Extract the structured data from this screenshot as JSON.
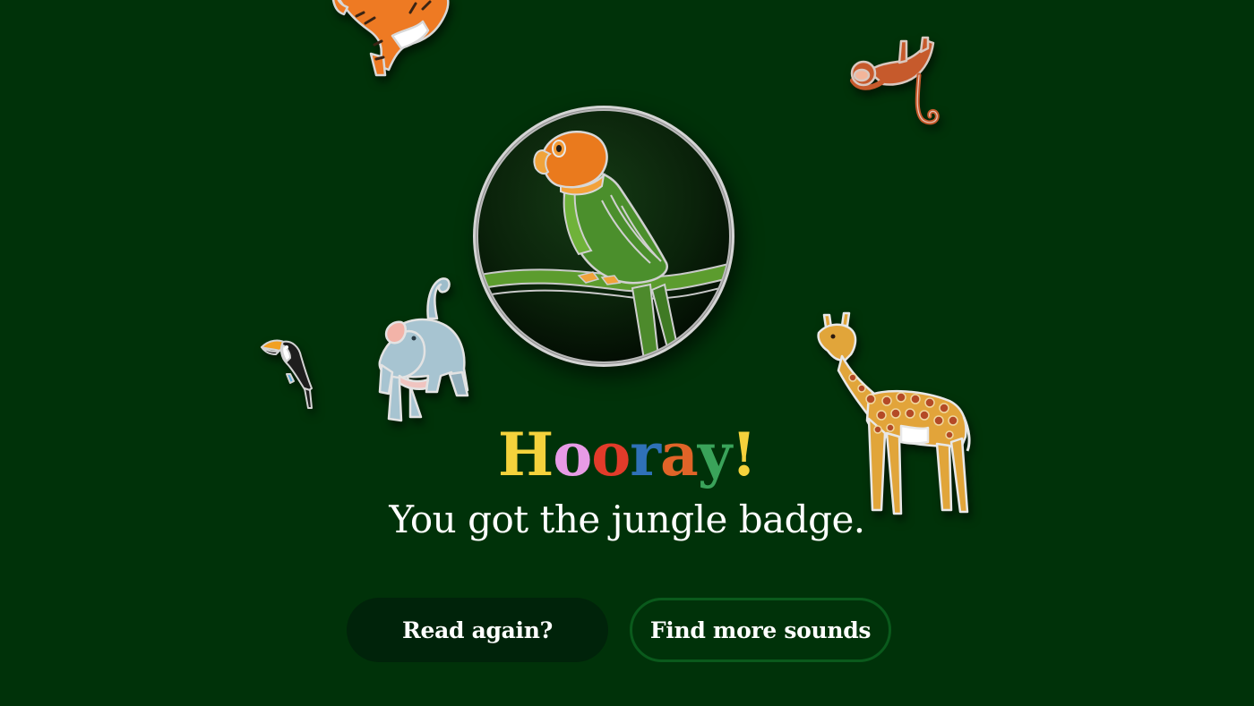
{
  "colors": {
    "background": "#003209",
    "read_button_bg": "#00230a",
    "find_button_border": "#0a5a1c",
    "text": "#ffffff"
  },
  "stickers": {
    "tiger": "tiger-sticker",
    "monkey": "monkey-sticker",
    "toucan": "toucan-sticker",
    "elephant": "elephant-sticker",
    "giraffe": "giraffe-sticker",
    "badge": "parrot-badge"
  },
  "headline": {
    "letters": [
      {
        "char": "H",
        "color": "#f5d23c"
      },
      {
        "char": "o",
        "color": "#e79be6"
      },
      {
        "char": "o",
        "color": "#e23b2a"
      },
      {
        "char": "r",
        "color": "#2f71b8"
      },
      {
        "char": "a",
        "color": "#e06428"
      },
      {
        "char": "y",
        "color": "#3aa35a"
      },
      {
        "char": "!",
        "color": "#f5d23c"
      }
    ]
  },
  "subtitle": "You got the jungle badge.",
  "buttons": {
    "read_again": "Read again?",
    "find_more": "Find more sounds"
  }
}
